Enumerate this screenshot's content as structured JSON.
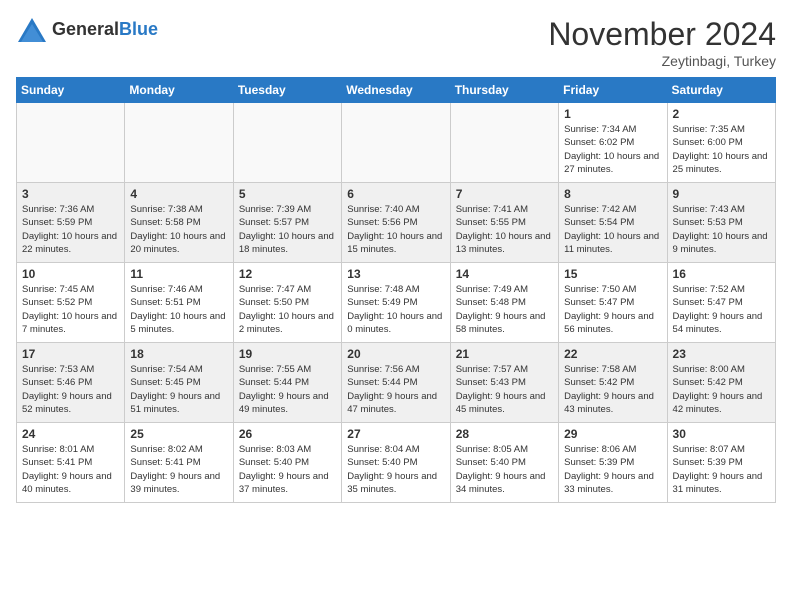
{
  "header": {
    "logo_general": "General",
    "logo_blue": "Blue",
    "month_title": "November 2024",
    "location": "Zeytinbagi, Turkey"
  },
  "days_of_week": [
    "Sunday",
    "Monday",
    "Tuesday",
    "Wednesday",
    "Thursday",
    "Friday",
    "Saturday"
  ],
  "weeks": [
    [
      {
        "day": "",
        "info": "",
        "empty": true
      },
      {
        "day": "",
        "info": "",
        "empty": true
      },
      {
        "day": "",
        "info": "",
        "empty": true
      },
      {
        "day": "",
        "info": "",
        "empty": true
      },
      {
        "day": "",
        "info": "",
        "empty": true
      },
      {
        "day": "1",
        "info": "Sunrise: 7:34 AM\nSunset: 6:02 PM\nDaylight: 10 hours and 27 minutes.",
        "empty": false
      },
      {
        "day": "2",
        "info": "Sunrise: 7:35 AM\nSunset: 6:00 PM\nDaylight: 10 hours and 25 minutes.",
        "empty": false
      }
    ],
    [
      {
        "day": "3",
        "info": "Sunrise: 7:36 AM\nSunset: 5:59 PM\nDaylight: 10 hours and 22 minutes.",
        "empty": false
      },
      {
        "day": "4",
        "info": "Sunrise: 7:38 AM\nSunset: 5:58 PM\nDaylight: 10 hours and 20 minutes.",
        "empty": false
      },
      {
        "day": "5",
        "info": "Sunrise: 7:39 AM\nSunset: 5:57 PM\nDaylight: 10 hours and 18 minutes.",
        "empty": false
      },
      {
        "day": "6",
        "info": "Sunrise: 7:40 AM\nSunset: 5:56 PM\nDaylight: 10 hours and 15 minutes.",
        "empty": false
      },
      {
        "day": "7",
        "info": "Sunrise: 7:41 AM\nSunset: 5:55 PM\nDaylight: 10 hours and 13 minutes.",
        "empty": false
      },
      {
        "day": "8",
        "info": "Sunrise: 7:42 AM\nSunset: 5:54 PM\nDaylight: 10 hours and 11 minutes.",
        "empty": false
      },
      {
        "day": "9",
        "info": "Sunrise: 7:43 AM\nSunset: 5:53 PM\nDaylight: 10 hours and 9 minutes.",
        "empty": false
      }
    ],
    [
      {
        "day": "10",
        "info": "Sunrise: 7:45 AM\nSunset: 5:52 PM\nDaylight: 10 hours and 7 minutes.",
        "empty": false
      },
      {
        "day": "11",
        "info": "Sunrise: 7:46 AM\nSunset: 5:51 PM\nDaylight: 10 hours and 5 minutes.",
        "empty": false
      },
      {
        "day": "12",
        "info": "Sunrise: 7:47 AM\nSunset: 5:50 PM\nDaylight: 10 hours and 2 minutes.",
        "empty": false
      },
      {
        "day": "13",
        "info": "Sunrise: 7:48 AM\nSunset: 5:49 PM\nDaylight: 10 hours and 0 minutes.",
        "empty": false
      },
      {
        "day": "14",
        "info": "Sunrise: 7:49 AM\nSunset: 5:48 PM\nDaylight: 9 hours and 58 minutes.",
        "empty": false
      },
      {
        "day": "15",
        "info": "Sunrise: 7:50 AM\nSunset: 5:47 PM\nDaylight: 9 hours and 56 minutes.",
        "empty": false
      },
      {
        "day": "16",
        "info": "Sunrise: 7:52 AM\nSunset: 5:47 PM\nDaylight: 9 hours and 54 minutes.",
        "empty": false
      }
    ],
    [
      {
        "day": "17",
        "info": "Sunrise: 7:53 AM\nSunset: 5:46 PM\nDaylight: 9 hours and 52 minutes.",
        "empty": false
      },
      {
        "day": "18",
        "info": "Sunrise: 7:54 AM\nSunset: 5:45 PM\nDaylight: 9 hours and 51 minutes.",
        "empty": false
      },
      {
        "day": "19",
        "info": "Sunrise: 7:55 AM\nSunset: 5:44 PM\nDaylight: 9 hours and 49 minutes.",
        "empty": false
      },
      {
        "day": "20",
        "info": "Sunrise: 7:56 AM\nSunset: 5:44 PM\nDaylight: 9 hours and 47 minutes.",
        "empty": false
      },
      {
        "day": "21",
        "info": "Sunrise: 7:57 AM\nSunset: 5:43 PM\nDaylight: 9 hours and 45 minutes.",
        "empty": false
      },
      {
        "day": "22",
        "info": "Sunrise: 7:58 AM\nSunset: 5:42 PM\nDaylight: 9 hours and 43 minutes.",
        "empty": false
      },
      {
        "day": "23",
        "info": "Sunrise: 8:00 AM\nSunset: 5:42 PM\nDaylight: 9 hours and 42 minutes.",
        "empty": false
      }
    ],
    [
      {
        "day": "24",
        "info": "Sunrise: 8:01 AM\nSunset: 5:41 PM\nDaylight: 9 hours and 40 minutes.",
        "empty": false
      },
      {
        "day": "25",
        "info": "Sunrise: 8:02 AM\nSunset: 5:41 PM\nDaylight: 9 hours and 39 minutes.",
        "empty": false
      },
      {
        "day": "26",
        "info": "Sunrise: 8:03 AM\nSunset: 5:40 PM\nDaylight: 9 hours and 37 minutes.",
        "empty": false
      },
      {
        "day": "27",
        "info": "Sunrise: 8:04 AM\nSunset: 5:40 PM\nDaylight: 9 hours and 35 minutes.",
        "empty": false
      },
      {
        "day": "28",
        "info": "Sunrise: 8:05 AM\nSunset: 5:40 PM\nDaylight: 9 hours and 34 minutes.",
        "empty": false
      },
      {
        "day": "29",
        "info": "Sunrise: 8:06 AM\nSunset: 5:39 PM\nDaylight: 9 hours and 33 minutes.",
        "empty": false
      },
      {
        "day": "30",
        "info": "Sunrise: 8:07 AM\nSunset: 5:39 PM\nDaylight: 9 hours and 31 minutes.",
        "empty": false
      }
    ]
  ]
}
